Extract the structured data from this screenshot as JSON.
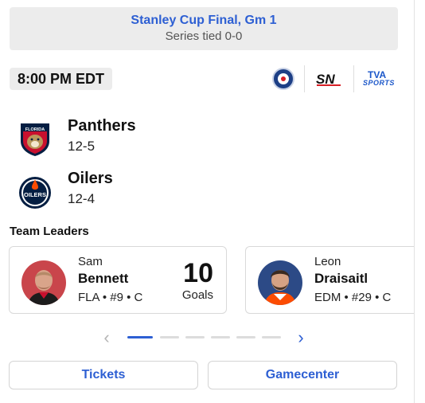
{
  "series": {
    "title": "Stanley Cup Final, Gm 1",
    "status": "Series tied 0-0"
  },
  "game": {
    "time": "8:00 PM EDT"
  },
  "broadcasters": [
    {
      "name": "Hockey Night in Canada",
      "icon": "hnic-logo-icon"
    },
    {
      "name": "SN",
      "icon": "sportsnet-logo-icon",
      "text": "SN"
    },
    {
      "name": "TVA Sports",
      "icon": "tva-sports-logo-icon",
      "text_top": "TVA",
      "text_bottom": "SPORTS"
    }
  ],
  "teams": [
    {
      "name": "Panthers",
      "record": "12-5",
      "logo_text": "FLORIDA",
      "logo_icon": "panthers-logo-icon"
    },
    {
      "name": "Oilers",
      "record": "12-4",
      "logo_text": "OILERS",
      "logo_icon": "oilers-logo-icon"
    }
  ],
  "leaders": {
    "heading": "Team Leaders",
    "players": [
      {
        "first": "Sam",
        "last": "Bennett",
        "meta": "FLA • #9 • C",
        "value": "10",
        "stat": "Goals"
      },
      {
        "first": "Leon",
        "last": "Draisaitl",
        "meta": "EDM • #29 • C",
        "value": "",
        "stat": ""
      }
    ]
  },
  "pager": {
    "prev": "‹",
    "next": "›",
    "total": 7,
    "active": 0
  },
  "actions": {
    "tickets": "Tickets",
    "gamecenter": "Gamecenter"
  },
  "colors": {
    "accent": "#2d5fd3",
    "panthers_red": "#c8102e",
    "panthers_navy": "#041e42",
    "oilers_blue": "#041e42",
    "oilers_orange": "#fc4c02"
  }
}
